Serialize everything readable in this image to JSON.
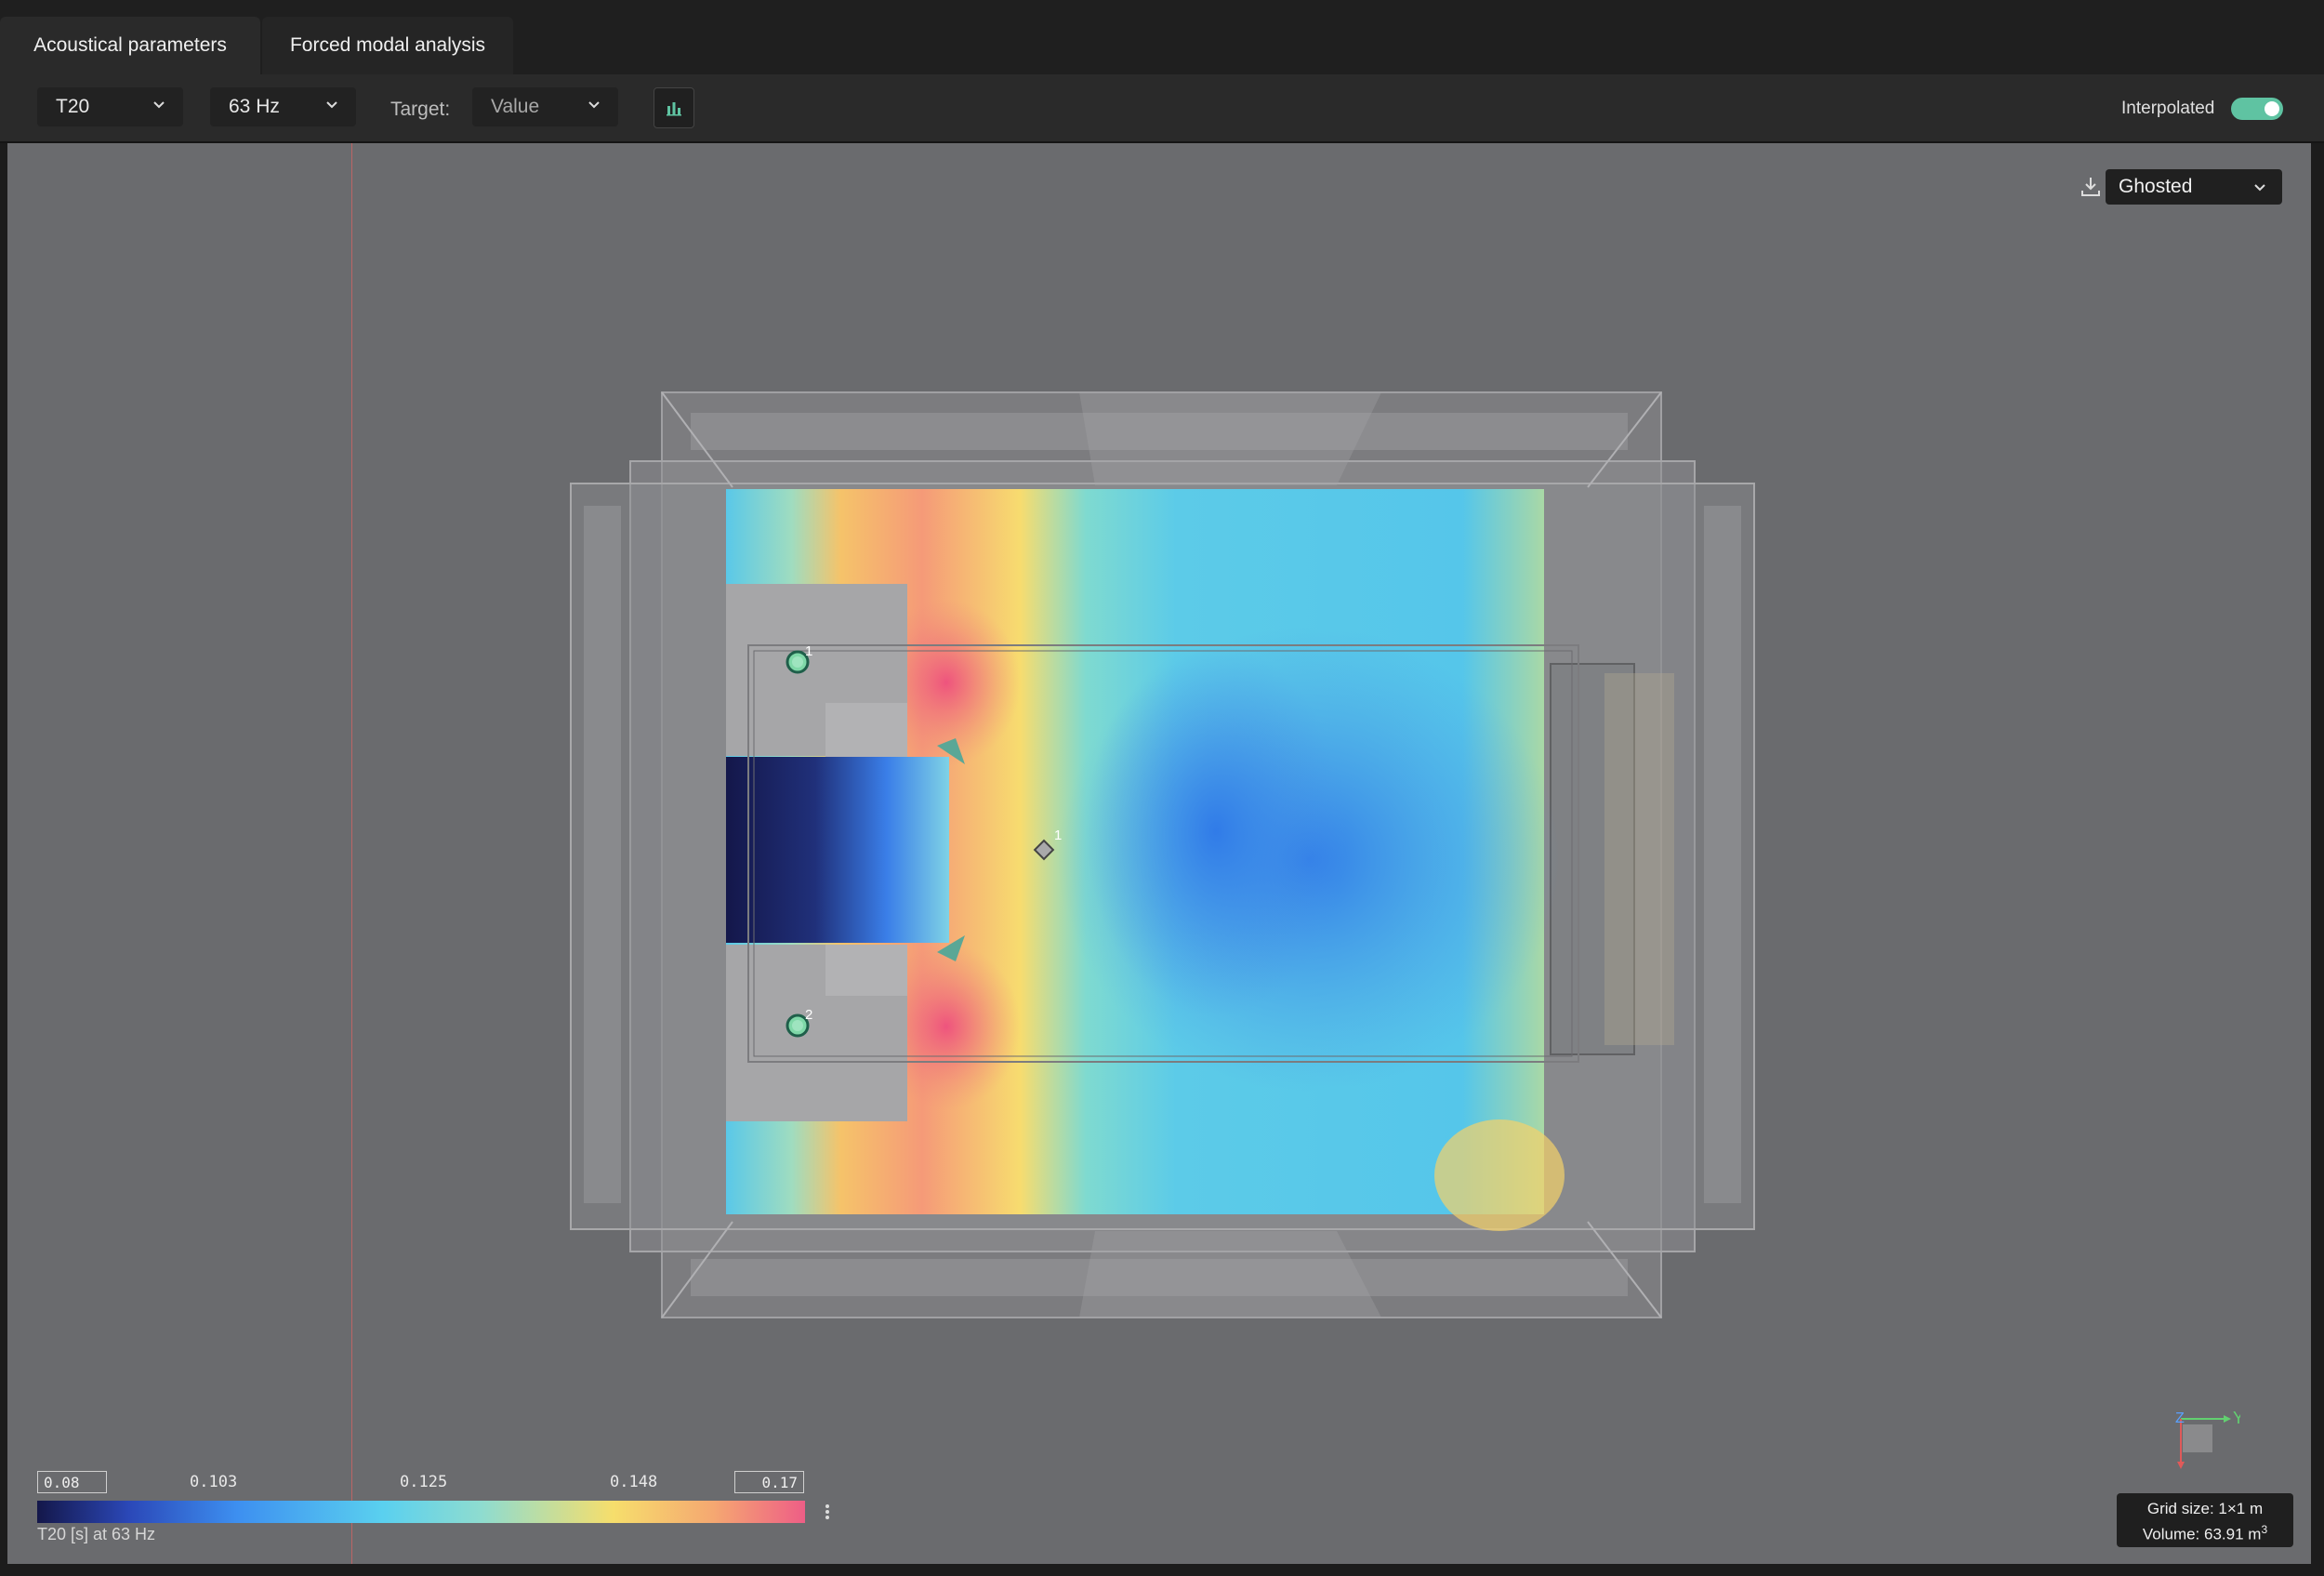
{
  "tabs": [
    {
      "label": "Acoustical parameters",
      "active": true
    },
    {
      "label": "Forced modal analysis",
      "active": false
    }
  ],
  "toolbar": {
    "parameter": "T20",
    "frequency": "63 Hz",
    "target_label": "Target:",
    "target_value": "Value",
    "chart_button_icon": "bar-chart-icon",
    "interpolated_label": "Interpolated",
    "interpolated_on": true
  },
  "viewport": {
    "view_mode": "Ghosted",
    "download_icon": "download-icon",
    "sources": [
      {
        "label": "1"
      },
      {
        "label": "2"
      }
    ],
    "receivers": [
      {
        "label": "1"
      }
    ],
    "axes": {
      "z": "Z",
      "y": "Y",
      "x": "X"
    }
  },
  "legend": {
    "min": "0.08",
    "max": "0.17",
    "ticks": [
      "0.103",
      "0.125",
      "0.148"
    ],
    "caption": "T20 [s] at 63 Hz",
    "colors": [
      "#14174a",
      "#3d8ff0",
      "#5ad0ef",
      "#f6de6c",
      "#ee5e86"
    ]
  },
  "info": {
    "grid_size": "Grid size: 1×1 m",
    "volume": "Volume: 63.91 m",
    "volume_unit_sup": "3"
  },
  "colors": {
    "accent": "#5fc3a2",
    "viewport_bg": "#6a6b6e"
  }
}
